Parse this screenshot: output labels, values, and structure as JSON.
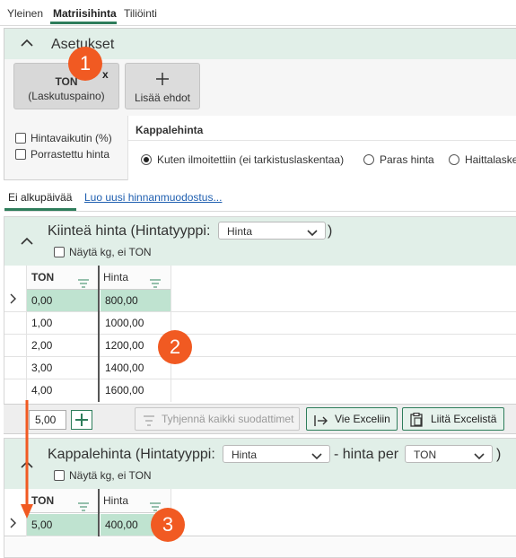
{
  "top_tabs": [
    {
      "label": "Yleinen",
      "active": false
    },
    {
      "label": "Matriisihinta",
      "active": true
    },
    {
      "label": "Tiliöinti",
      "active": false
    }
  ],
  "settings": {
    "title": "Asetukset",
    "ton_chip": {
      "line1": "TON",
      "line2": "(Laskutuspaino)",
      "remove": "x"
    },
    "add_condition": "Lisää ehdot",
    "checkboxes": [
      {
        "label": "Hintavaikutin (%)",
        "checked": false
      },
      {
        "label": "Porrastettu hinta",
        "checked": false
      }
    ],
    "kappalehinta": {
      "title": "Kappalehinta",
      "options": [
        {
          "label": "Kuten ilmoitettiin (ei tarkistuslaskentaa)",
          "selected": true
        },
        {
          "label": "Paras hinta",
          "selected": false
        },
        {
          "label": "Haittalaske",
          "selected": false
        }
      ]
    }
  },
  "sub_tabs": {
    "active": "Ei alkupäivää",
    "link": "Luo uusi hinnanmuodostus..."
  },
  "fixed_price": {
    "title_prefix": "Kiinteä hinta (Hintatyyppi:",
    "type_value": "Hinta",
    "title_suffix": ")",
    "show_kg": "Näytä kg, ei TON",
    "columns": [
      "TON",
      "Hinta"
    ],
    "rows": [
      {
        "ton": "0,00",
        "price": "800,00"
      },
      {
        "ton": "1,00",
        "price": "1000,00"
      },
      {
        "ton": "2,00",
        "price": "1200,00"
      },
      {
        "ton": "3,00",
        "price": "1400,00"
      },
      {
        "ton": "4,00",
        "price": "1600,00"
      }
    ]
  },
  "toolbar": {
    "step_value": "5,00",
    "clear_filters": "Tyhjennä kaikki suodattimet",
    "export_excel": "Vie Exceliin",
    "paste_excel": "Liitä Excelistä"
  },
  "unit_price": {
    "title_prefix": "Kappalehinta (Hintatyyppi:",
    "type_value": "Hinta",
    "per_label": "- hinta per",
    "per_value": "TON",
    "title_suffix": ")",
    "show_kg": "Näytä kg, ei TON",
    "columns": [
      "TON",
      "Hinta"
    ],
    "rows": [
      {
        "ton": "5,00",
        "price": "400,00"
      }
    ]
  },
  "annotations": [
    "1",
    "2",
    "3"
  ],
  "colors": {
    "accent": "#2e7d5b",
    "header_bg": "#e1efe8",
    "highlight": "#bfe3d0",
    "badge": "#f15a22"
  }
}
